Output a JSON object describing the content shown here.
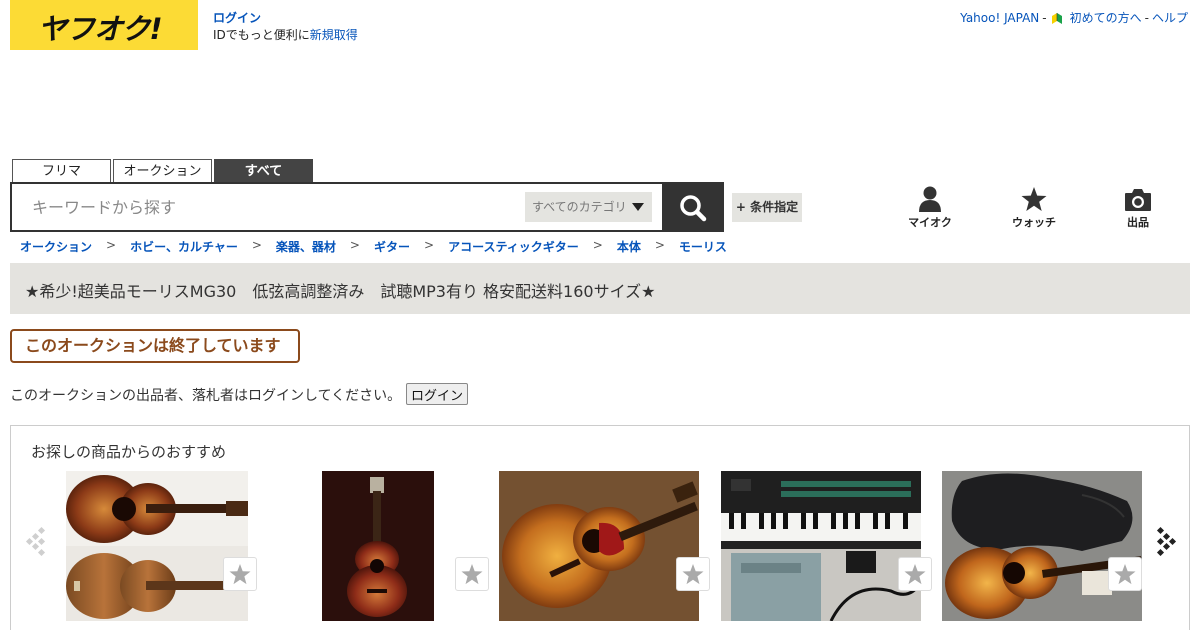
{
  "header": {
    "logo_text": "ヤフオク!",
    "login_label": "ログイン",
    "login_desc": "IDでもっと便利に",
    "register_label": "新規取得",
    "links": [
      "Yahoo! JAPAN",
      "初めての方へ",
      "ヘルプ"
    ],
    "link_separator": "-"
  },
  "search": {
    "tabs": [
      "フリマ",
      "オークション",
      "すべて"
    ],
    "active_tab": "すべて",
    "placeholder": "キーワードから探す",
    "category": "すべてのカテゴリ",
    "condition_label": "+ 条件指定"
  },
  "utility": {
    "myauction": "マイオク",
    "watch": "ウォッチ",
    "sell": "出品"
  },
  "breadcrumb": [
    "オークション",
    "ホビー、カルチャー",
    "楽器、器材",
    "ギター",
    "アコースティックギター",
    "本体",
    "モーリス"
  ],
  "breadcrumb_separator": ">",
  "item": {
    "title": "★希少!超美品モーリスMG30　低弦高調整済み　試聴MP3有り 格安配送料160サイズ★",
    "ended_label": "このオークションは終了しています",
    "login_note": "このオークションの出品者、落札者はログインしてください。",
    "login_button": "ログイン"
  },
  "recommend": {
    "heading": "お探しの商品からのおすすめ",
    "products": [
      {
        "image": "sunburst-acoustic-guitar-front-back"
      },
      {
        "image": "small-sunburst-acoustic-guitar"
      },
      {
        "image": "sunburst-jumbo-acoustic-guitar"
      },
      {
        "image": "yamaha-keyboard-synth"
      },
      {
        "image": "sunburst-guitar-with-gig-bag"
      }
    ]
  },
  "colors": {
    "logo_bg": "#fcdb35",
    "link": "#0654ba",
    "ended": "#8b4a1c",
    "title_bar": "#e4e3df"
  }
}
